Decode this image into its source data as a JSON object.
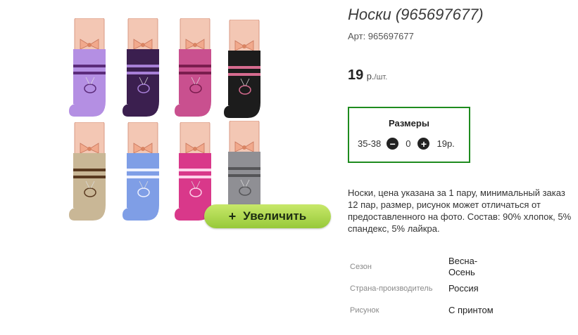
{
  "product": {
    "title": "Носки (965697677)",
    "article": "Арт: 965697677",
    "price": "19",
    "currency": "р.",
    "unit": "/шт."
  },
  "zoom_button": {
    "icon": "plus-icon",
    "label": "Увеличить"
  },
  "sizes": {
    "title": "Размеры",
    "size": "35-38",
    "quantity": "0",
    "price": "19р."
  },
  "description": "Носки, цена указана за 1 пару, минимальный заказ 12 пар, размер, рисунок может отличаться от предоставленного на фото. Состав: 90% хлопок, 5% спандекс, 5% лайкра.",
  "properties": [
    {
      "label": "Сезон",
      "value": "Весна-Осень"
    },
    {
      "label": "Страна-производитель",
      "value": "Россия"
    },
    {
      "label": "Рисунок",
      "value": "С принтом"
    }
  ],
  "socks": [
    {
      "color": "#b48fe3",
      "stripe": "#5b2b7a"
    },
    {
      "color": "#3b1f4f",
      "stripe": "#a77fd6"
    },
    {
      "color": "#c9508f",
      "stripe": "#7a1d4e"
    },
    {
      "color": "#1c1c1c",
      "stripe": "#d66b8f"
    },
    {
      "color": "#c9b796",
      "stripe": "#5a3a20"
    },
    {
      "color": "#7f9ee6",
      "stripe": "#eef1ff"
    },
    {
      "color": "#d9388a",
      "stripe": "#ffd2ea"
    },
    {
      "color": "#8f8f94",
      "stripe": "#555558"
    }
  ]
}
